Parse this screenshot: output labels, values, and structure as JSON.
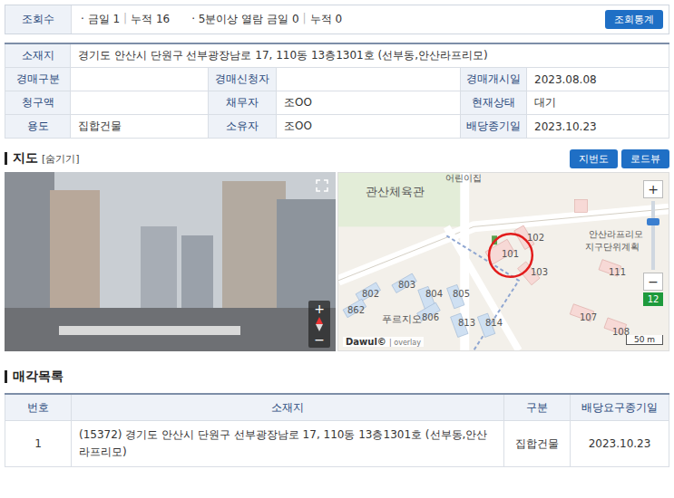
{
  "views": {
    "label": "조회수",
    "groups": [
      {
        "lead": "· 금일 1",
        "tail": "누적 16"
      },
      {
        "lead": "· 5분이상 열람  금일 0",
        "tail": "누적 0"
      }
    ],
    "separator": "|",
    "button": "조회통계"
  },
  "info": {
    "address": {
      "label": "소재지",
      "value": "경기도 안산시 단원구 선부광장남로 17, 110동 13층1301호 (선부동,안산라프리모)"
    },
    "rows": [
      [
        {
          "label": "경매구분",
          "value": ""
        },
        {
          "label": "경매신청자",
          "value": ""
        },
        {
          "label": "경매개시일",
          "value": "2023.08.08"
        }
      ],
      [
        {
          "label": "청구액",
          "value": ""
        },
        {
          "label": "채무자",
          "value": "조OO"
        },
        {
          "label": "현재상태",
          "value": "대기"
        }
      ],
      [
        {
          "label": "용도",
          "value": "집합건물"
        },
        {
          "label": "소유자",
          "value": "조OO"
        },
        {
          "label": "배당종기일",
          "value": "2023.10.23"
        }
      ]
    ]
  },
  "map_section": {
    "title": "지도",
    "toggle": "[숨기기]",
    "buttons": [
      "지번도",
      "로드뷰"
    ],
    "streetview": {
      "zoom_in": "+",
      "zoom_out": "−"
    },
    "map": {
      "labels": [
        "관산체육관",
        "어린이집",
        "101",
        "102",
        "103",
        "111",
        "107",
        "108",
        "862",
        "802",
        "803",
        "804",
        "805",
        "806",
        "813",
        "814",
        "푸르지오",
        "안산라프리모",
        "지구단위계획"
      ],
      "zoom_in": "+",
      "zoom_out": "−",
      "zoom_level": "12",
      "zoom_value": 0.7,
      "scale": "50 m",
      "logo": "Dawul©",
      "overlay": "| overlay"
    }
  },
  "list": {
    "title": "매각목록",
    "columns": [
      "번호",
      "소재지",
      "구분",
      "배당요구종기일"
    ],
    "rows": [
      {
        "no": "1",
        "address": "(15372) 경기도 안산시 단원구 선부광장남로 17, 110동 13층1301호 (선부동,안산라프리모)",
        "type": "집합건물",
        "deadline": "2023.10.23"
      }
    ]
  }
}
